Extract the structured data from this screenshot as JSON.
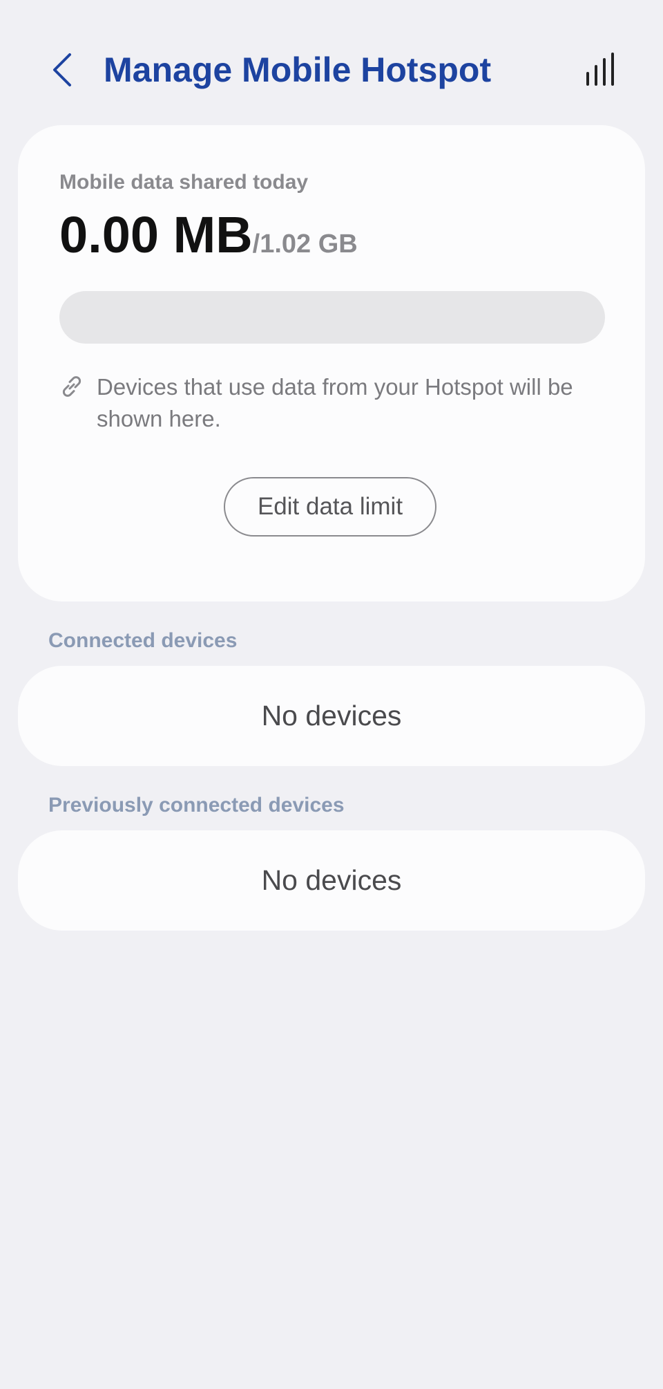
{
  "header": {
    "back_icon": "chevron-left-icon",
    "title": "Manage Mobile Hotspot",
    "stats_icon": "bar-chart-icon"
  },
  "usage": {
    "label": "Mobile data shared today",
    "used": "0.00 MB",
    "limit": "/1.02 GB",
    "progress_fraction": 0,
    "info_icon": "link-icon",
    "info_text": "Devices that use data from your Hotspot will be shown here.",
    "edit_button": "Edit data limit"
  },
  "connected": {
    "label": "Connected devices",
    "empty_text": "No devices"
  },
  "previous": {
    "label": "Previously connected devices",
    "empty_text": "No devices"
  },
  "colors": {
    "accent": "#1d43a0",
    "background": "#f0f0f4",
    "card": "#fcfcfd",
    "section_label": "#8a9ab4"
  }
}
